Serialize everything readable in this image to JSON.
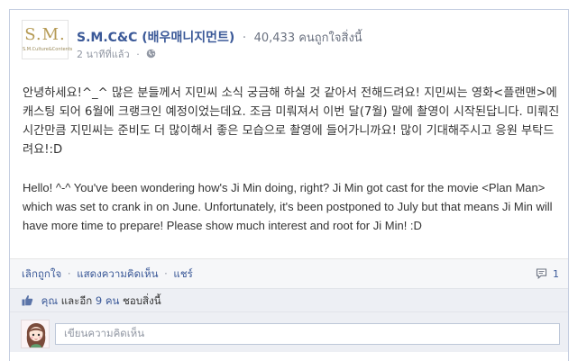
{
  "page": {
    "logo_text": "S.M.",
    "logo_subtext": "S.M.Culture&Contents",
    "name": "S.M.C&C (배우매니지먼트)",
    "likes": "40,433 คนถูกใจสิ่งนี้",
    "timestamp": "2 นาทีที่แล้ว"
  },
  "post": {
    "korean": "안녕하세요!^_^ 많은 분들께서 지민씨 소식 궁금해 하실 것 같아서 전해드려요! 지민씨는 영화<플랜맨>에 캐스팅 되어 6월에 크랭크인 예정이었는데요. 조금 미뤄져서 이번 달(7월) 말에 촬영이 시작된답니다. 미뤄진 시간만큼 지민씨는 준비도 더 많이해서 좋은 모습으로 촬영에 들어가니까요! 많이 기대해주시고 응원 부탁드려요!:D",
    "english": "Hello! ^-^ You've been wondering how's Ji Min doing, right? Ji Min got cast for the movie <Plan Man> which was set to crank in on June. Unfortunately, it's been postponed to July but that means Ji Min will have more time to prepare! Please show much interest and root for Ji Min! :D"
  },
  "actions": {
    "unlike": "เลิกถูกใจ",
    "comment": "แสดงความคิดเห็น",
    "share": "แชร์",
    "separator": "·",
    "comment_count": "1"
  },
  "likes_bar": {
    "you": "คุณ",
    "and": "และอีก",
    "count": "9 คน",
    "suffix": "ชอบสิ่งนี้"
  },
  "comment_box": {
    "placeholder": "เขียนความคิดเห็น"
  },
  "colors": {
    "link": "#3b5998",
    "muted": "#9197a3",
    "bar_bg": "#edeff4",
    "logo_gold": "#b59a54"
  },
  "icons": {
    "globe": "globe-icon",
    "comment": "comment-bubble-icon",
    "like": "thumbs-up-icon"
  }
}
